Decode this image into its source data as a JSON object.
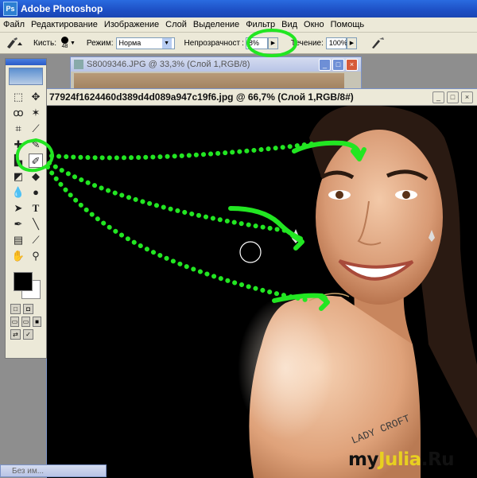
{
  "window": {
    "title": "Adobe Photoshop"
  },
  "menu": [
    "Файл",
    "Редактирование",
    "Изображение",
    "Слой",
    "Выделение",
    "Фильтр",
    "Вид",
    "Окно",
    "Помощь"
  ],
  "options": {
    "brush_label": "Кисть:",
    "brush_size": "48",
    "mode_label": "Режим:",
    "mode_value": "Норма",
    "opacity_label": "Непрозрачност",
    "opacity_value": "8%",
    "flow_label": "Течение:",
    "flow_value": "100%"
  },
  "back_document": {
    "title": "S8009346.JPG @ 33,3% (Слой 1,RGB/8)"
  },
  "main_document": {
    "title": "77924f1624460d389d4d089a947c19f6.jpg @ 66,7% (Слой 1,RGB/8#)"
  },
  "minimized_window": {
    "title": "Без им..."
  },
  "tattoo_text": "LADY CROFT",
  "watermark": {
    "part1": "my",
    "part2": "Julia",
    "part3": ".Ru"
  },
  "annotation_color": "#22e622",
  "tool_icons": [
    "marquee-icon",
    "move-icon",
    "lasso-icon",
    "magic-wand-icon",
    "crop-icon",
    "slice-icon",
    "healing-icon",
    "brush-icon",
    "stamp-icon",
    "history-brush-icon",
    "eraser-icon",
    "gradient-icon",
    "blur-icon",
    "dodge-icon",
    "path-select-icon",
    "type-icon",
    "pen-icon",
    "line-icon",
    "notes-icon",
    "eyedropper-icon",
    "hand-icon",
    "zoom-icon"
  ]
}
